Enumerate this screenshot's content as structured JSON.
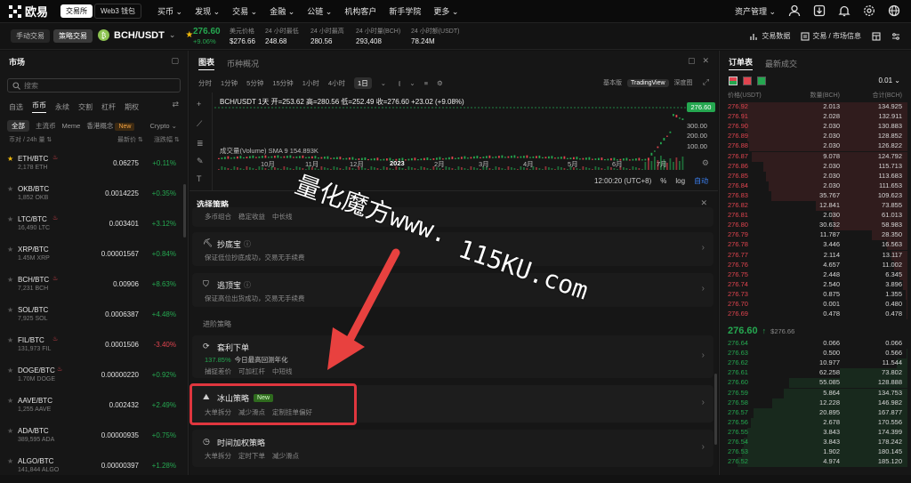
{
  "topnav": {
    "logo": "欧易",
    "tabs": [
      "交易所",
      "Web3 钱包"
    ],
    "menu": [
      "买币",
      "发现",
      "交易",
      "金融",
      "公链",
      "机构客户",
      "新手学院",
      "更多"
    ],
    "asset": "资产管理"
  },
  "pairbar": {
    "modes": [
      "手动交易",
      "策略交易"
    ],
    "pair": "BCH/USDT",
    "price": "276.60",
    "change": "+9.06%",
    "stats": [
      {
        "label": "美元价格",
        "value": "$276.66"
      },
      {
        "label": "24 小时最低",
        "value": "248.68"
      },
      {
        "label": "24 小时最高",
        "value": "280.56"
      },
      {
        "label": "24 小时量(BCH)",
        "value": "293,408"
      },
      {
        "label": "24 小时额(USDT)",
        "value": "78.24M"
      }
    ],
    "right": [
      "交易数据",
      "交易 / 市场信息"
    ]
  },
  "market": {
    "title": "市场",
    "search_placeholder": "搜索",
    "tabs": [
      "自选",
      "币币",
      "永续",
      "交割",
      "杠杆",
      "期权"
    ],
    "filters": [
      "全部",
      "主流币",
      "Meme",
      "香港概念",
      "New",
      "Crypto"
    ],
    "header": {
      "pair": "币对 / 24h 量",
      "price": "最新价",
      "change": "涨跌幅"
    },
    "rows": [
      {
        "pair": "ETH/BTC",
        "vol": "2,178 ETH",
        "price": "0.06275",
        "change": "+0.11%"
      },
      {
        "pair": "OKB/BTC",
        "vol": "1,852 OKB",
        "price": "0.0014225",
        "change": "+0.35%"
      },
      {
        "pair": "LTC/BTC",
        "vol": "16,490 LTC",
        "price": "0.003401",
        "change": "+3.12%"
      },
      {
        "pair": "XRP/BTC",
        "vol": "1.45M XRP",
        "price": "0.00001567",
        "change": "+0.84%"
      },
      {
        "pair": "BCH/BTC",
        "vol": "7,231 BCH",
        "price": "0.00906",
        "change": "+8.63%"
      },
      {
        "pair": "SOL/BTC",
        "vol": "7,925 SOL",
        "price": "0.0006387",
        "change": "+4.48%"
      },
      {
        "pair": "FIL/BTC",
        "vol": "131,973 FIL",
        "price": "0.0001506",
        "change": "-3.40%"
      },
      {
        "pair": "DOGE/BTC",
        "vol": "1.70M DOGE",
        "price": "0.00000220",
        "change": "+0.92%"
      },
      {
        "pair": "AAVE/BTC",
        "vol": "1,255 AAVE",
        "price": "0.002432",
        "change": "+2.49%"
      },
      {
        "pair": "ADA/BTC",
        "vol": "389,595 ADA",
        "price": "0.00000935",
        "change": "+0.75%"
      },
      {
        "pair": "ALGO/BTC",
        "vol": "141,844 ALGO",
        "price": "0.00000397",
        "change": "+1.28%"
      }
    ]
  },
  "chart": {
    "tabs": [
      "图表",
      "币种概况"
    ],
    "intervals": [
      "分时",
      "1分钟",
      "5分钟",
      "15分钟",
      "1小时",
      "4小时",
      "1日"
    ],
    "views": [
      "基本版",
      "TradingView",
      "深度图"
    ],
    "ohlc": "BCH/USDT  1天  开=253.62 高=280.56 低=252.49 收=276.60 +23.02 (+9.08%)",
    "price_tag": "276.60",
    "yticks": [
      "300.00",
      "200.00",
      "100.00"
    ],
    "vol_label": "成交量(Volume) SMA 9  154.893K",
    "xticks": [
      "10月",
      "11月",
      "12月",
      "2023",
      "2月",
      "3月",
      "4月",
      "5月",
      "6月",
      "7月"
    ],
    "time": "12:00:20 (UTC+8)",
    "opts": [
      "%",
      "log",
      "自动"
    ]
  },
  "strategy": {
    "title": "选择策略",
    "cards": [
      {
        "name": "抄底宝",
        "desc": "保证低位抄底成功，交易无手续费"
      },
      {
        "name": "逃顶宝",
        "desc": "保证高位出货成功，交易无手续费"
      }
    ],
    "advanced": "进阶策略",
    "arb": {
      "name": "套利下单",
      "rate": "137.85%",
      "rate_desc": "今日最高回测年化",
      "tags": [
        "捕捉差价",
        "可加杠杆",
        "中短线"
      ]
    },
    "iceberg": {
      "name": "冰山策略",
      "badge": "New",
      "tags": [
        "大单拆分",
        "减少滑点",
        "定制挂单偏好"
      ]
    },
    "twap": {
      "name": "时间加权策略",
      "tags": [
        "大单拆分",
        "定时下单",
        "减少滑点"
      ]
    },
    "top_partial": [
      "多币组合",
      "稳定收益",
      "中长线"
    ]
  },
  "watermark": {
    "line1": "量化魔方www.",
    "line2": "115KU.com"
  },
  "orderbook": {
    "tabs": [
      "订单表",
      "最新成交"
    ],
    "step": "0.01",
    "header": [
      "价格(USDT)",
      "数量(BCH)",
      "合计(BCH)"
    ],
    "asks": [
      [
        "276.92",
        "2.013",
        "134.925"
      ],
      [
        "276.91",
        "2.028",
        "132.911"
      ],
      [
        "276.90",
        "2.030",
        "130.883"
      ],
      [
        "276.89",
        "2.030",
        "128.852"
      ],
      [
        "276.88",
        "2.030",
        "126.822"
      ],
      [
        "276.87",
        "9.078",
        "124.792"
      ],
      [
        "276.86",
        "2.030",
        "115.713"
      ],
      [
        "276.85",
        "2.030",
        "113.683"
      ],
      [
        "276.84",
        "2.030",
        "111.653"
      ],
      [
        "276.83",
        "35.767",
        "109.623"
      ],
      [
        "276.82",
        "12.841",
        "73.855"
      ],
      [
        "276.81",
        "2.030",
        "61.013"
      ],
      [
        "276.80",
        "30.632",
        "58.983"
      ],
      [
        "276.79",
        "11.787",
        "28.350"
      ],
      [
        "276.78",
        "3.446",
        "16.563"
      ],
      [
        "276.77",
        "2.114",
        "13.117"
      ],
      [
        "276.76",
        "4.657",
        "11.002"
      ],
      [
        "276.75",
        "2.448",
        "6.345"
      ],
      [
        "276.74",
        "2.540",
        "3.896"
      ],
      [
        "276.73",
        "0.875",
        "1.355"
      ],
      [
        "276.70",
        "0.001",
        "0.480"
      ],
      [
        "276.69",
        "0.478",
        "0.478"
      ]
    ],
    "mid": "276.60",
    "mid_usd": "$276.66",
    "bids": [
      [
        "276.64",
        "0.066",
        "0.066"
      ],
      [
        "276.63",
        "0.500",
        "0.566"
      ],
      [
        "276.62",
        "10.977",
        "11.544"
      ],
      [
        "276.61",
        "62.258",
        "73.802"
      ],
      [
        "276.60",
        "55.085",
        "128.888"
      ],
      [
        "276.59",
        "5.864",
        "134.753"
      ],
      [
        "276.58",
        "12.228",
        "146.982"
      ],
      [
        "276.57",
        "20.895",
        "167.877"
      ],
      [
        "276.56",
        "2.678",
        "170.556"
      ],
      [
        "276.55",
        "3.843",
        "174.399"
      ],
      [
        "276.54",
        "3.843",
        "178.242"
      ],
      [
        "276.53",
        "1.902",
        "180.145"
      ],
      [
        "276.52",
        "4.974",
        "185.120"
      ]
    ]
  },
  "colors": {
    "green": "#25a750",
    "red": "#e0444f",
    "highlight": "#e0363e",
    "arrow": "#e8413f"
  }
}
